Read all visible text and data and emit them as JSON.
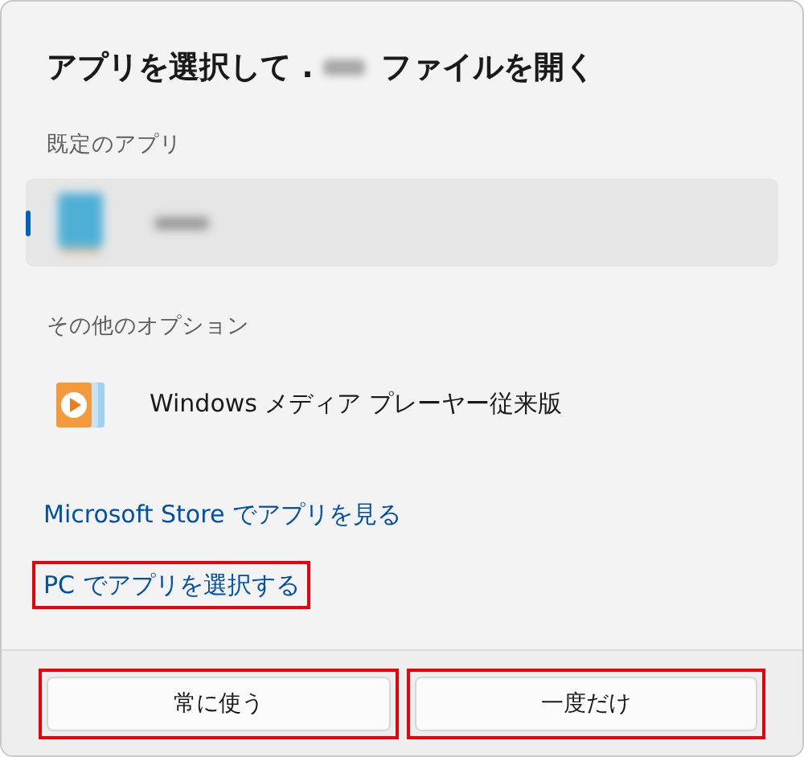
{
  "dialog": {
    "title_before": "アプリを選択して .",
    "title_after": "ファイルを開く"
  },
  "sections": [
    {
      "label": "既定のアプリ",
      "apps": [
        {
          "kind": "blurred",
          "selected": true
        }
      ]
    },
    {
      "label": "その他のオプション",
      "apps": [
        {
          "kind": "media",
          "name": "Windows メディア プレーヤー従来版",
          "selected": false
        }
      ]
    }
  ],
  "links": [
    {
      "label": "Microsoft Store でアプリを見る",
      "highlighted": false
    },
    {
      "label": "PC でアプリを選択する",
      "highlighted": true
    }
  ],
  "buttons": [
    {
      "label": "常に使う",
      "highlighted": true
    },
    {
      "label": "一度だけ",
      "highlighted": true
    }
  ]
}
